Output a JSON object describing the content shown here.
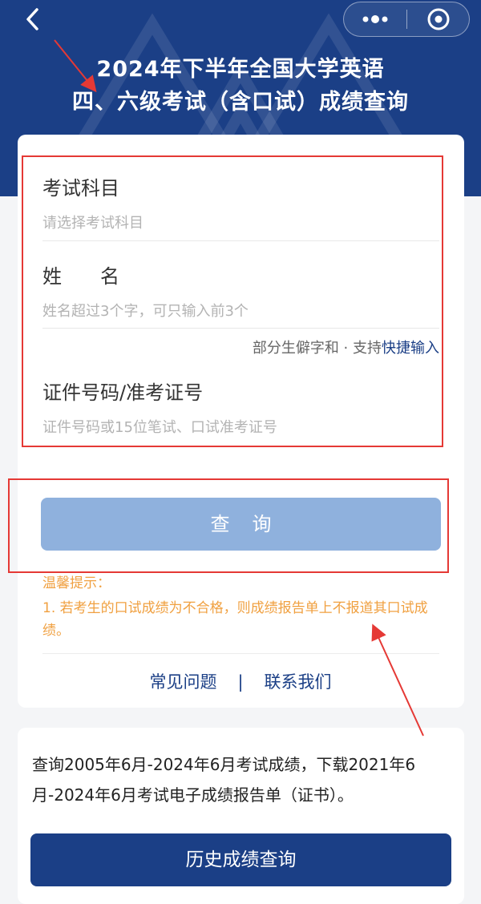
{
  "header": {
    "title_line1": "2024年下半年全国大学英语",
    "title_line2": "四、六级考试（含口试）成绩查询"
  },
  "form": {
    "subject": {
      "label": "考试科目",
      "placeholder": "请选择考试科目"
    },
    "name": {
      "label": "姓　　名",
      "placeholder": "姓名超过3个字，可只输入前3个"
    },
    "rare_char_hint": {
      "prefix": "部分生僻字和 · 支持",
      "link": "快捷输入"
    },
    "id_number": {
      "label": "证件号码/准考证号",
      "placeholder": "证件号码或15位笔试、口试准考证号"
    }
  },
  "query_button": "查询",
  "tips": {
    "title": "温馨提示：",
    "items": [
      "1. 若考生的口试成绩为不合格，则成绩报告单上不报道其口试成绩。"
    ]
  },
  "footer_links": {
    "faq": "常见问题",
    "separator": "|",
    "contact": "联系我们"
  },
  "history": {
    "text": "查询2005年6月-2024年6月考试成绩，下载2021年6月-2024年6月考试电子成绩报告单（证书）。",
    "button": "历史成绩查询"
  },
  "colors": {
    "brand": "#1b3f86",
    "button_disabled": "#8fb1dd",
    "tip": "#f0a040",
    "annotation": "#e53935"
  },
  "icons": [
    "back-arrow-icon",
    "more-dots-icon",
    "close-circle-icon"
  ]
}
